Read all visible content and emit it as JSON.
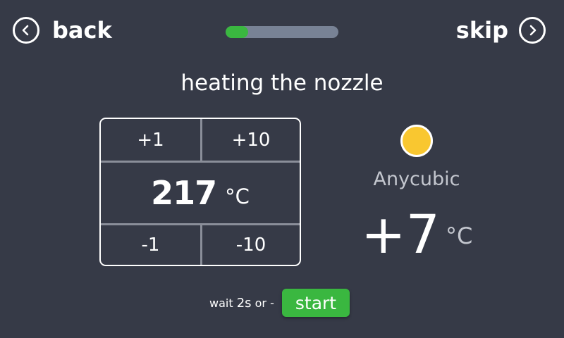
{
  "header": {
    "back_label": "back",
    "skip_label": "skip",
    "progress": 0.2
  },
  "title": "heating the nozzle",
  "temperature": {
    "value": "217",
    "unit": "°C",
    "steps": {
      "plus_one": "+1",
      "plus_ten": "+10",
      "minus_one": "-1",
      "minus_ten": "-10"
    }
  },
  "status": {
    "indicator_color": "#f9c730",
    "name": "Anycubic",
    "offset": "+7",
    "unit": "°C"
  },
  "footer": {
    "wait_prefix": "wait ",
    "wait_seconds": "2s",
    "wait_suffix": " or -",
    "start_label": "start"
  },
  "colors": {
    "background": "#363a47",
    "accent_green": "#3ab740",
    "track": "#788295"
  },
  "icons": {
    "back": "chevron-left-circle-icon",
    "skip": "chevron-right-circle-icon"
  }
}
